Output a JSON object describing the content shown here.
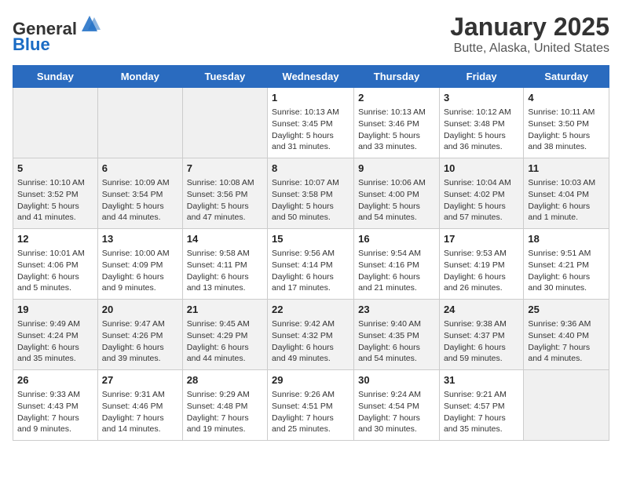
{
  "logo": {
    "general": "General",
    "blue": "Blue"
  },
  "header": {
    "month": "January 2025",
    "location": "Butte, Alaska, United States"
  },
  "weekdays": [
    "Sunday",
    "Monday",
    "Tuesday",
    "Wednesday",
    "Thursday",
    "Friday",
    "Saturday"
  ],
  "weeks": [
    [
      {
        "day": "",
        "empty": true
      },
      {
        "day": "",
        "empty": true
      },
      {
        "day": "",
        "empty": true
      },
      {
        "day": "1",
        "sunrise": "10:13 AM",
        "sunset": "3:45 PM",
        "daylight": "5 hours and 31 minutes."
      },
      {
        "day": "2",
        "sunrise": "10:13 AM",
        "sunset": "3:46 PM",
        "daylight": "5 hours and 33 minutes."
      },
      {
        "day": "3",
        "sunrise": "10:12 AM",
        "sunset": "3:48 PM",
        "daylight": "5 hours and 36 minutes."
      },
      {
        "day": "4",
        "sunrise": "10:11 AM",
        "sunset": "3:50 PM",
        "daylight": "5 hours and 38 minutes."
      }
    ],
    [
      {
        "day": "5",
        "sunrise": "10:10 AM",
        "sunset": "3:52 PM",
        "daylight": "5 hours and 41 minutes."
      },
      {
        "day": "6",
        "sunrise": "10:09 AM",
        "sunset": "3:54 PM",
        "daylight": "5 hours and 44 minutes."
      },
      {
        "day": "7",
        "sunrise": "10:08 AM",
        "sunset": "3:56 PM",
        "daylight": "5 hours and 47 minutes."
      },
      {
        "day": "8",
        "sunrise": "10:07 AM",
        "sunset": "3:58 PM",
        "daylight": "5 hours and 50 minutes."
      },
      {
        "day": "9",
        "sunrise": "10:06 AM",
        "sunset": "4:00 PM",
        "daylight": "5 hours and 54 minutes."
      },
      {
        "day": "10",
        "sunrise": "10:04 AM",
        "sunset": "4:02 PM",
        "daylight": "5 hours and 57 minutes."
      },
      {
        "day": "11",
        "sunrise": "10:03 AM",
        "sunset": "4:04 PM",
        "daylight": "6 hours and 1 minute."
      }
    ],
    [
      {
        "day": "12",
        "sunrise": "10:01 AM",
        "sunset": "4:06 PM",
        "daylight": "6 hours and 5 minutes."
      },
      {
        "day": "13",
        "sunrise": "10:00 AM",
        "sunset": "4:09 PM",
        "daylight": "6 hours and 9 minutes."
      },
      {
        "day": "14",
        "sunrise": "9:58 AM",
        "sunset": "4:11 PM",
        "daylight": "6 hours and 13 minutes."
      },
      {
        "day": "15",
        "sunrise": "9:56 AM",
        "sunset": "4:14 PM",
        "daylight": "6 hours and 17 minutes."
      },
      {
        "day": "16",
        "sunrise": "9:54 AM",
        "sunset": "4:16 PM",
        "daylight": "6 hours and 21 minutes."
      },
      {
        "day": "17",
        "sunrise": "9:53 AM",
        "sunset": "4:19 PM",
        "daylight": "6 hours and 26 minutes."
      },
      {
        "day": "18",
        "sunrise": "9:51 AM",
        "sunset": "4:21 PM",
        "daylight": "6 hours and 30 minutes."
      }
    ],
    [
      {
        "day": "19",
        "sunrise": "9:49 AM",
        "sunset": "4:24 PM",
        "daylight": "6 hours and 35 minutes."
      },
      {
        "day": "20",
        "sunrise": "9:47 AM",
        "sunset": "4:26 PM",
        "daylight": "6 hours and 39 minutes."
      },
      {
        "day": "21",
        "sunrise": "9:45 AM",
        "sunset": "4:29 PM",
        "daylight": "6 hours and 44 minutes."
      },
      {
        "day": "22",
        "sunrise": "9:42 AM",
        "sunset": "4:32 PM",
        "daylight": "6 hours and 49 minutes."
      },
      {
        "day": "23",
        "sunrise": "9:40 AM",
        "sunset": "4:35 PM",
        "daylight": "6 hours and 54 minutes."
      },
      {
        "day": "24",
        "sunrise": "9:38 AM",
        "sunset": "4:37 PM",
        "daylight": "6 hours and 59 minutes."
      },
      {
        "day": "25",
        "sunrise": "9:36 AM",
        "sunset": "4:40 PM",
        "daylight": "7 hours and 4 minutes."
      }
    ],
    [
      {
        "day": "26",
        "sunrise": "9:33 AM",
        "sunset": "4:43 PM",
        "daylight": "7 hours and 9 minutes."
      },
      {
        "day": "27",
        "sunrise": "9:31 AM",
        "sunset": "4:46 PM",
        "daylight": "7 hours and 14 minutes."
      },
      {
        "day": "28",
        "sunrise": "9:29 AM",
        "sunset": "4:48 PM",
        "daylight": "7 hours and 19 minutes."
      },
      {
        "day": "29",
        "sunrise": "9:26 AM",
        "sunset": "4:51 PM",
        "daylight": "7 hours and 25 minutes."
      },
      {
        "day": "30",
        "sunrise": "9:24 AM",
        "sunset": "4:54 PM",
        "daylight": "7 hours and 30 minutes."
      },
      {
        "day": "31",
        "sunrise": "9:21 AM",
        "sunset": "4:57 PM",
        "daylight": "7 hours and 35 minutes."
      },
      {
        "day": "",
        "empty": true
      }
    ]
  ]
}
